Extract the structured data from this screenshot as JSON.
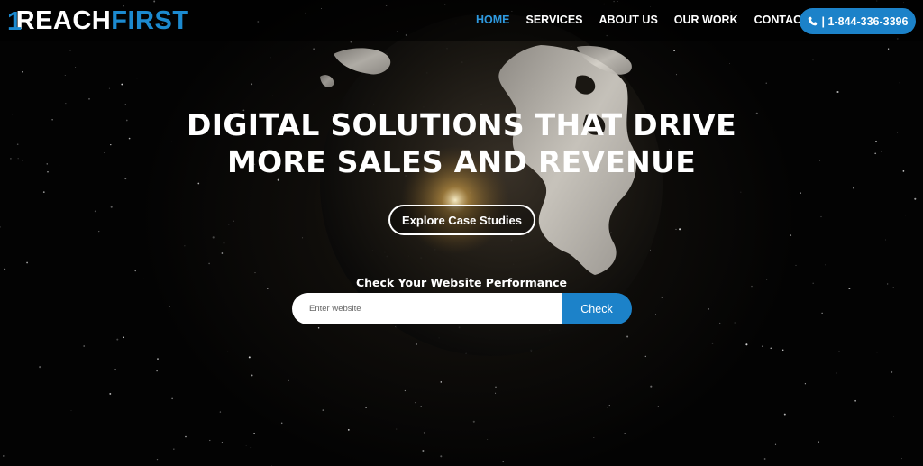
{
  "header": {
    "logo": {
      "part1": "REACH",
      "part2": "FIRST",
      "icon": "logo-mark"
    },
    "nav": [
      {
        "label": "HOME",
        "active": true
      },
      {
        "label": "SERVICES",
        "active": false
      },
      {
        "label": "ABOUT US",
        "active": false
      },
      {
        "label": "OUR WORK",
        "active": false
      },
      {
        "label": "CONTACT US",
        "active": false
      }
    ],
    "phone": {
      "label": "| 1-844-336-3396",
      "icon": "phone-icon"
    }
  },
  "hero": {
    "headline_line1": "DIGITAL SOLUTIONS THAT DRIVE",
    "headline_line2": "MORE SALES AND REVENUE",
    "cta_label": "Explore Case Studies",
    "background": "globe-at-night-with-stars"
  },
  "website_check": {
    "label": "Check Your Website Performance",
    "placeholder": "Enter website",
    "value": "",
    "button_label": "Check"
  },
  "colors": {
    "accent": "#1c82c9",
    "nav_active": "#2e9ae0",
    "background": "#030303",
    "text": "#ffffff"
  }
}
